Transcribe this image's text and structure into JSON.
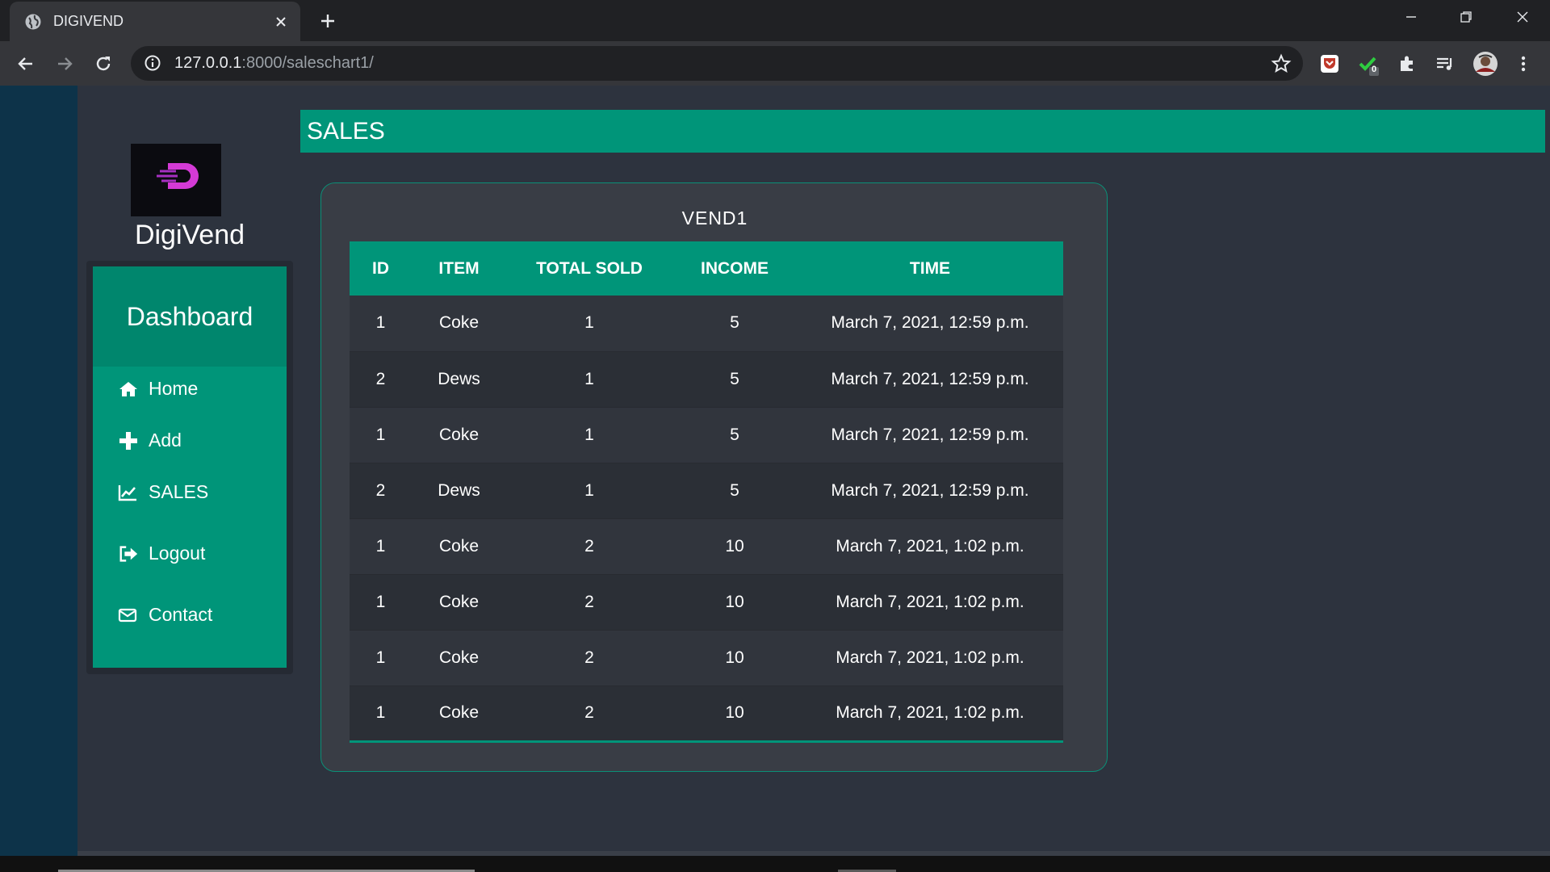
{
  "browser": {
    "tab_title": "DIGIVEND",
    "url_host": "127.0.0.1",
    "url_path": ":8000/saleschart1/",
    "extension_badge": "0"
  },
  "brand": {
    "logo_text": "DIGIVEND",
    "name": "DigiVend"
  },
  "sidebar": {
    "header": "Dashboard",
    "items": [
      {
        "label": "Home",
        "icon": "home-icon"
      },
      {
        "label": "Add",
        "icon": "plus-icon"
      },
      {
        "label": "SALES",
        "icon": "chart-icon"
      },
      {
        "label": "Logout",
        "icon": "logout-icon"
      },
      {
        "label": "Contact",
        "icon": "envelope-icon"
      }
    ]
  },
  "header": {
    "title": "SALES"
  },
  "sales_card": {
    "title": "VEND1",
    "columns": [
      "ID",
      "ITEM",
      "TOTAL SOLD",
      "INCOME",
      "TIME"
    ],
    "rows": [
      [
        "1",
        "Coke",
        "1",
        "5",
        "March 7, 2021, 12:59 p.m."
      ],
      [
        "2",
        "Dews",
        "1",
        "5",
        "March 7, 2021, 12:59 p.m."
      ],
      [
        "1",
        "Coke",
        "1",
        "5",
        "March 7, 2021, 12:59 p.m."
      ],
      [
        "2",
        "Dews",
        "1",
        "5",
        "March 7, 2021, 12:59 p.m."
      ],
      [
        "1",
        "Coke",
        "2",
        "10",
        "March 7, 2021, 1:02 p.m."
      ],
      [
        "1",
        "Coke",
        "2",
        "10",
        "March 7, 2021, 1:02 p.m."
      ],
      [
        "1",
        "Coke",
        "2",
        "10",
        "March 7, 2021, 1:02 p.m."
      ],
      [
        "1",
        "Coke",
        "2",
        "10",
        "March 7, 2021, 1:02 p.m."
      ]
    ]
  },
  "colors": {
    "accent": "#009579",
    "page_bg": "#2d333e",
    "left_strip": "#0d3349",
    "card_bg": "#393d45"
  }
}
